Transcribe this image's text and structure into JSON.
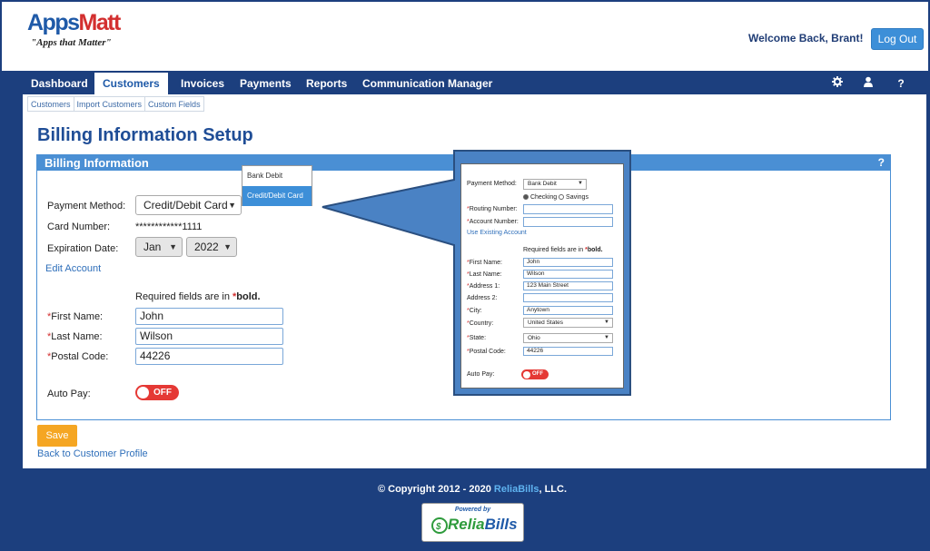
{
  "header": {
    "logo_word1": "Apps",
    "logo_word2": "Matt",
    "tagline": "\"Apps that Matter\"",
    "welcome": "Welcome Back, Brant!",
    "logout_label": "Log Out"
  },
  "nav": {
    "items": [
      "Dashboard",
      "Customers",
      "Invoices",
      "Payments",
      "Reports",
      "Communication Manager"
    ],
    "active": "Customers",
    "icons": [
      "gear-icon",
      "user-icon",
      "help-icon"
    ]
  },
  "subnav": {
    "items": [
      "Customers",
      "Import Customers",
      "Custom Fields"
    ]
  },
  "page": {
    "title": "Billing Information Setup"
  },
  "panel": {
    "heading": "Billing Information",
    "help": "?",
    "payment_method_label": "Payment Method:",
    "payment_method_value": "Credit/Debit Card",
    "card_number_label": "Card Number:",
    "card_number_value": "************1111",
    "expiration_label": "Expiration Date:",
    "exp_month": "Jan",
    "exp_year": "2022",
    "edit_account": "Edit Account",
    "required_note": "Required fields are in",
    "required_star": "*",
    "required_bold": "bold.",
    "req_mark": "*",
    "first_name_label": "First Name:",
    "first_name_value": "John",
    "last_name_label": "Last Name:",
    "last_name_value": "Wilson",
    "postal_label": "Postal Code:",
    "postal_value": "44226",
    "autopay_label": "Auto Pay:",
    "autopay_state": "OFF"
  },
  "dropdown": {
    "options": [
      "Bank Debit",
      "Credit/Debit Card"
    ],
    "selected": "Credit/Debit Card"
  },
  "actions": {
    "save": "Save",
    "back": "Back to Customer Profile"
  },
  "inset": {
    "payment_method_label": "Payment Method:",
    "payment_method_value": "Bank Debit",
    "checking": "Checking",
    "savings": "Savings",
    "routing_label": "Routing Number:",
    "account_label": "Account Number:",
    "use_existing": "Use Existing Account",
    "required_note": "Required fields are in",
    "required_star": "*",
    "required_bold": "bold.",
    "req_mark": "*",
    "first_name_label": "First Name:",
    "first_name_value": "John",
    "last_name_label": "Last Name:",
    "last_name_value": "Wilson",
    "address1_label": "Address 1:",
    "address1_value": "123 Main Street",
    "address2_label": "Address 2:",
    "city_label": "City:",
    "city_value": "Anytown",
    "country_label": "Country:",
    "country_value": "United States",
    "state_label": "State:",
    "state_value": "Ohio",
    "postal_label": "Postal Code:",
    "postal_value": "44226",
    "autopay_label": "Auto Pay:",
    "autopay_state": "OFF"
  },
  "footer": {
    "copyright_prefix": "© Copyright 2012 - 2020",
    "brand": "ReliaBills",
    "copyright_suffix": ", LLC.",
    "powered_by": "Powered by",
    "badge_word1": "Relia",
    "badge_word2": "Bills"
  },
  "colors": {
    "nav_bg": "#1c3f7e",
    "accent": "#4a8fd4",
    "save": "#f5a623",
    "toggle_off": "#e53935",
    "required": "#d32f2f"
  }
}
